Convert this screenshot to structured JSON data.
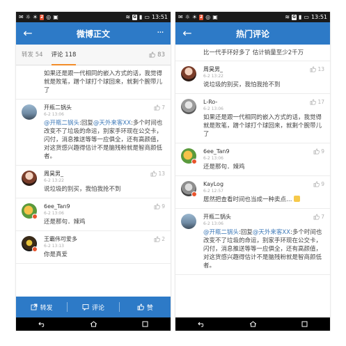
{
  "status_bar": {
    "badge_left": "2",
    "badge_mid": "G",
    "time": "13:51"
  },
  "left_screen": {
    "title": "微博正文",
    "tabs": {
      "reposts": "转发 54",
      "comments": "评论 118",
      "likes": "83"
    },
    "partial_text": "如果还是跟一代相同的嵌入方式的话，我觉得就是败笔，蹭个球打个球回来，就剩个腕带儿了",
    "comments": [
      {
        "name": "开瓶二锅头",
        "date": "6-2 13:06",
        "likes": "7",
        "mention1": "@开瓶二锅头",
        "reply_mid": ":回复",
        "mention2": "@天外来客XX",
        "text": ":多个时间也改变不了垃圾的命运，别家手环现在公交卡，闪付，消息推送等等一应俱全，还有高颜值，对这货感兴趣得估计不是脑残粉就是智商颜低者。"
      },
      {
        "name": "周昊男_",
        "date": "6-2 13:22",
        "likes": "13",
        "text": "说垃圾的别买，我怕我抢不到"
      },
      {
        "name": "6ee_Tan9",
        "date": "6-2 13:06",
        "likes": "9",
        "text": "还是那句．辣鸡"
      },
      {
        "name": "王霸伟可爱多",
        "date": "6-2 13:13",
        "likes": "2",
        "text": "你是真爱"
      }
    ],
    "actions": {
      "repost": "转发",
      "comment": "评论",
      "like": "赞"
    }
  },
  "right_screen": {
    "title": "热门评论",
    "partial_text": "比一代手环好多了 估计销量至少2千万",
    "comments": [
      {
        "name": "周昊男_",
        "date": "6-2 13:22",
        "likes": "13",
        "text": "说垃圾的别买，我怕我抢不到"
      },
      {
        "name": "L-Ro-",
        "date": "6-2 13:06",
        "likes": "17",
        "text": "如果还是跟一代相同的嵌入方式的话，我觉得就是败笔，蹭个球打个球回来，就剩个腕带儿了"
      },
      {
        "name": "6ee_Tan9",
        "date": "6-2 13:06",
        "likes": "9",
        "text": "还是那句．辣鸡"
      },
      {
        "name": "KayLog",
        "date": "6-2 12:57",
        "likes": "9",
        "text": "居然把查看时间也当成一种卖点…"
      },
      {
        "name": "开瓶二锅头",
        "date": "6-2 13:06",
        "likes": "7",
        "mention1": "@开瓶二锅头",
        "reply_mid": ":回复",
        "mention2": "@天外来客XX",
        "text": ":多个时间也改变不了垃圾的命运，别家手环现在公交卡，闪付，消息推送等等一应俱全，还有高颜值，对这货感兴趣得估计不是脑残粉就是智商颜低者。"
      }
    ]
  },
  "colors": {
    "brand_blue": "#2d7ac7",
    "mention_blue": "#3d79b8",
    "tab_underline": "#f28c28"
  }
}
